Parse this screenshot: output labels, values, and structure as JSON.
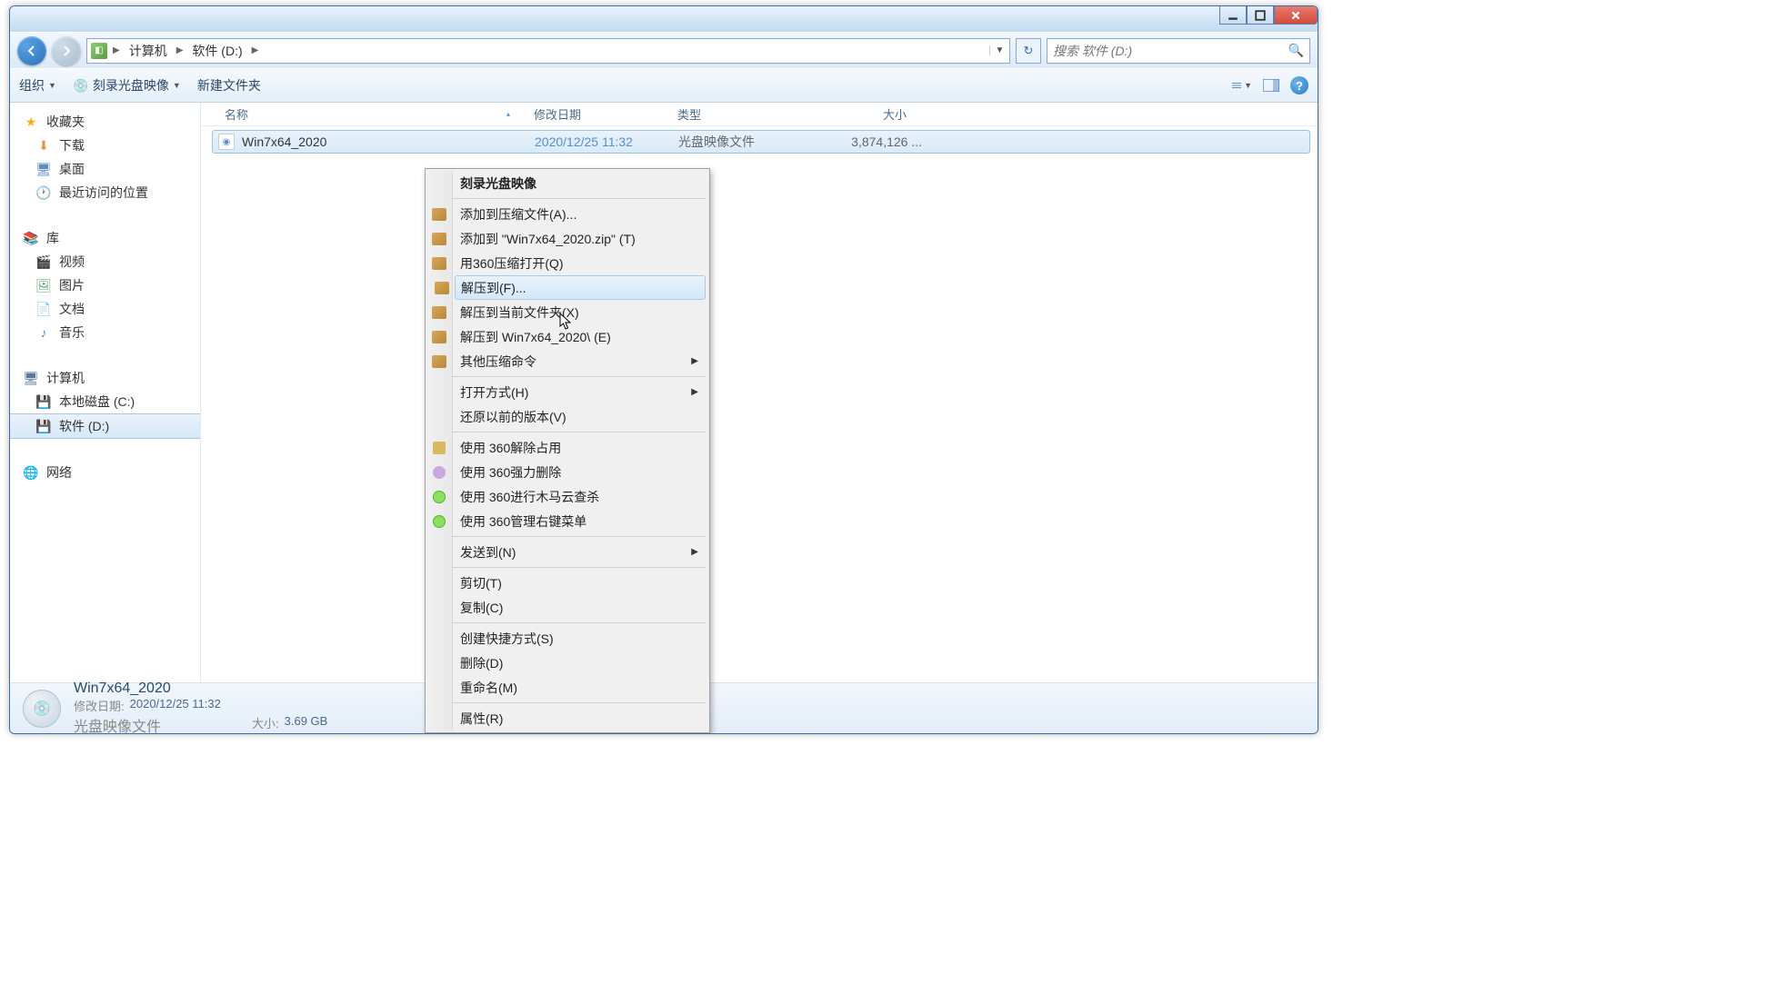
{
  "breadcrumb": {
    "seg1": "计算机",
    "seg2": "软件 (D:)"
  },
  "search": {
    "placeholder": "搜索 软件 (D:)"
  },
  "toolbar": {
    "organize": "组织",
    "burn": "刻录光盘映像",
    "newfolder": "新建文件夹"
  },
  "sidebar": {
    "favorites": "收藏夹",
    "downloads": "下载",
    "desktop": "桌面",
    "recent": "最近访问的位置",
    "libraries": "库",
    "videos": "视频",
    "pictures": "图片",
    "documents": "文档",
    "music": "音乐",
    "computer": "计算机",
    "drive_c": "本地磁盘 (C:)",
    "drive_d": "软件 (D:)",
    "network": "网络"
  },
  "columns": {
    "name": "名称",
    "date": "修改日期",
    "type": "类型",
    "size": "大小"
  },
  "file": {
    "name": "Win7x64_2020",
    "date": "2020/12/25 11:32",
    "type": "光盘映像文件",
    "size": "3,874,126 ..."
  },
  "details": {
    "title": "Win7x64_2020",
    "type": "光盘映像文件",
    "date_label": "修改日期:",
    "date_val": "2020/12/25 11:32",
    "size_label": "大小:",
    "size_val": "3.69 GB"
  },
  "context": {
    "burn": "刻录光盘映像",
    "add_archive": "添加到压缩文件(A)...",
    "add_zip": "添加到 \"Win7x64_2020.zip\" (T)",
    "open_360zip": "用360压缩打开(Q)",
    "extract_to": "解压到(F)...",
    "extract_here": "解压到当前文件夹(X)",
    "extract_folder": "解压到 Win7x64_2020\\ (E)",
    "other_zip": "其他压缩命令",
    "open_with": "打开方式(H)",
    "restore": "还原以前的版本(V)",
    "unlock_360": "使用 360解除占用",
    "force_del_360": "使用 360强力删除",
    "scan_360": "使用 360进行木马云查杀",
    "menu_360": "使用 360管理右键菜单",
    "send_to": "发送到(N)",
    "cut": "剪切(T)",
    "copy": "复制(C)",
    "shortcut": "创建快捷方式(S)",
    "delete": "删除(D)",
    "rename": "重命名(M)",
    "properties": "属性(R)"
  }
}
